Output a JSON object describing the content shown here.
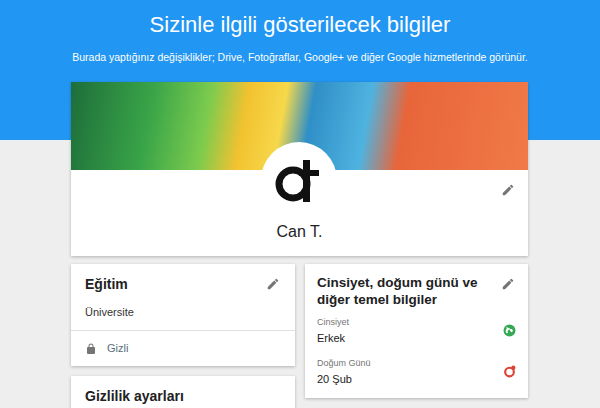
{
  "header": {
    "title": "Sizinle ilgili gösterilecek bilgiler",
    "subtitle": "Burada yaptığınız değişiklikler; Drive, Fotoğraflar, Google+ ve diğer Google hizmetlerinde görünür."
  },
  "profile": {
    "name": "Can T."
  },
  "education": {
    "title": "Eğitim",
    "value": "Üniversite",
    "privacy": "Gizli"
  },
  "basics": {
    "title": "Cinsiyet, doğum günü ve diğer temel bilgiler",
    "fields": [
      {
        "label": "Cinsiyet",
        "value": "Erkek",
        "kind": "public"
      },
      {
        "label": "Doğum Günü",
        "value": "20 Şub",
        "kind": "custom"
      }
    ]
  },
  "privacy_card": {
    "title": "Gizlilik ayarları"
  }
}
